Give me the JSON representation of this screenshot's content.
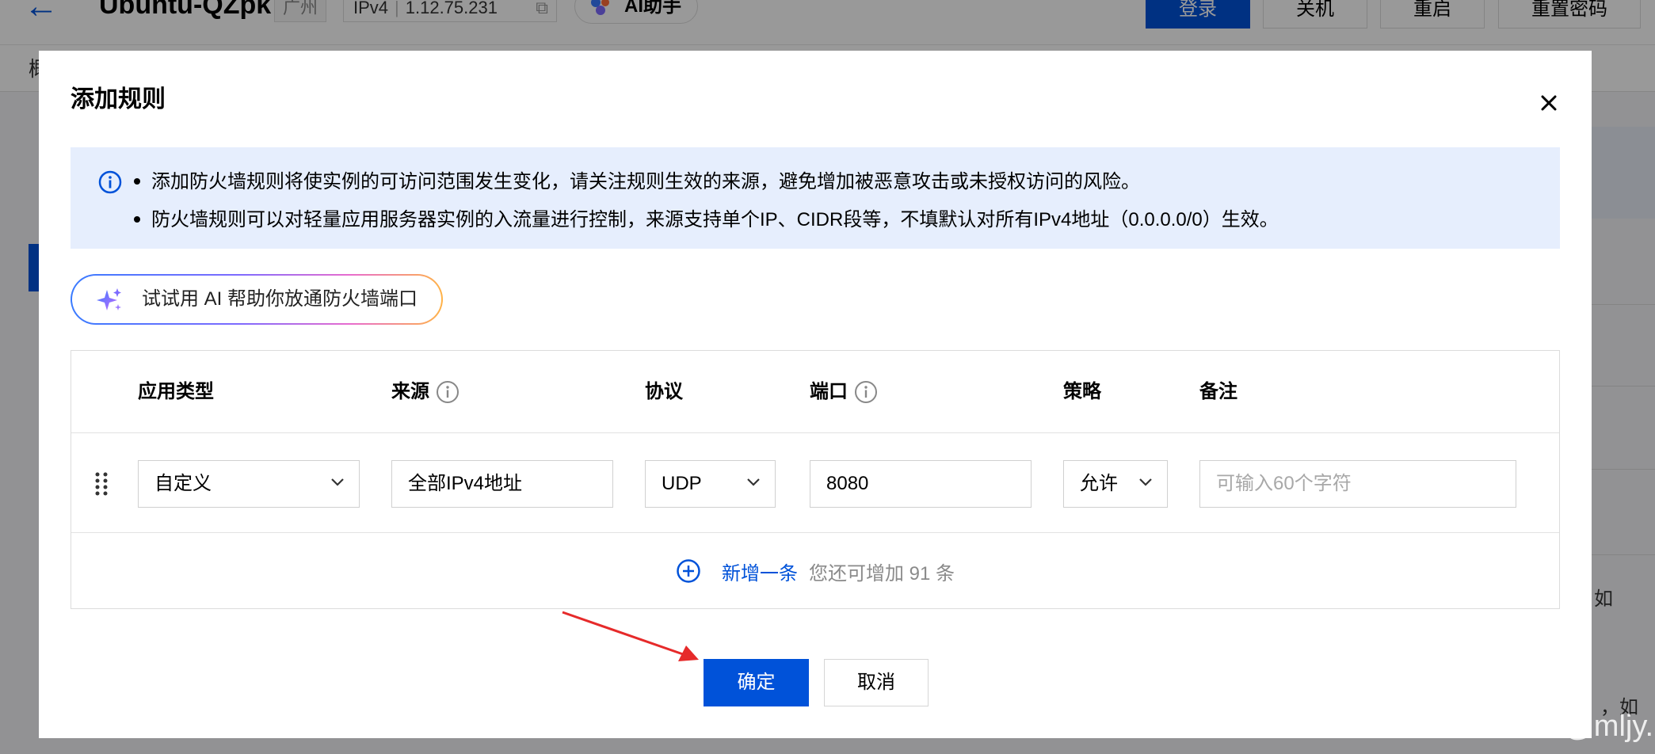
{
  "background": {
    "title": "Ubuntu-QZpk",
    "region": "广州",
    "ip_type": "IPv4",
    "ip_address": "1.12.75.231",
    "ai_assistant_label": "AI助手",
    "actions": [
      "登录",
      "关机",
      "重启",
      "重置密码"
    ],
    "subtab": "概",
    "right_texts": [
      "如",
      "，如"
    ]
  },
  "dialog": {
    "title": "添加规则",
    "notice": [
      "添加防火墙规则将使实例的可访问范围发生变化，请关注规则生效的来源，避免增加被恶意攻击或未授权访问的风险。",
      "防火墙规则可以对轻量应用服务器实例的入流量进行控制，来源支持单个IP、CIDR段等，不填默认对所有IPv4地址（0.0.0.0/0）生效。"
    ],
    "ai_prompt": "试试用 AI 帮助你放通防火墙端口",
    "table": {
      "headers": {
        "app_type": "应用类型",
        "source": "来源",
        "protocol": "协议",
        "port": "端口",
        "policy": "策略",
        "remark": "备注"
      },
      "row": {
        "app_type": "自定义",
        "source": "全部IPv4地址",
        "protocol": "UDP",
        "port": "8080",
        "policy": "允许",
        "remark": "",
        "remark_placeholder": "可输入60个字符"
      },
      "add_label": "新增一条",
      "add_hint": "您还可增加 91 条"
    },
    "confirm_label": "确定",
    "cancel_label": "取消"
  },
  "watermark": "CSDN @mljy.",
  "colors": {
    "primary": "#0052d9",
    "notice_bg": "#e6eefd",
    "annotation_arrow": "#e62a2a"
  }
}
